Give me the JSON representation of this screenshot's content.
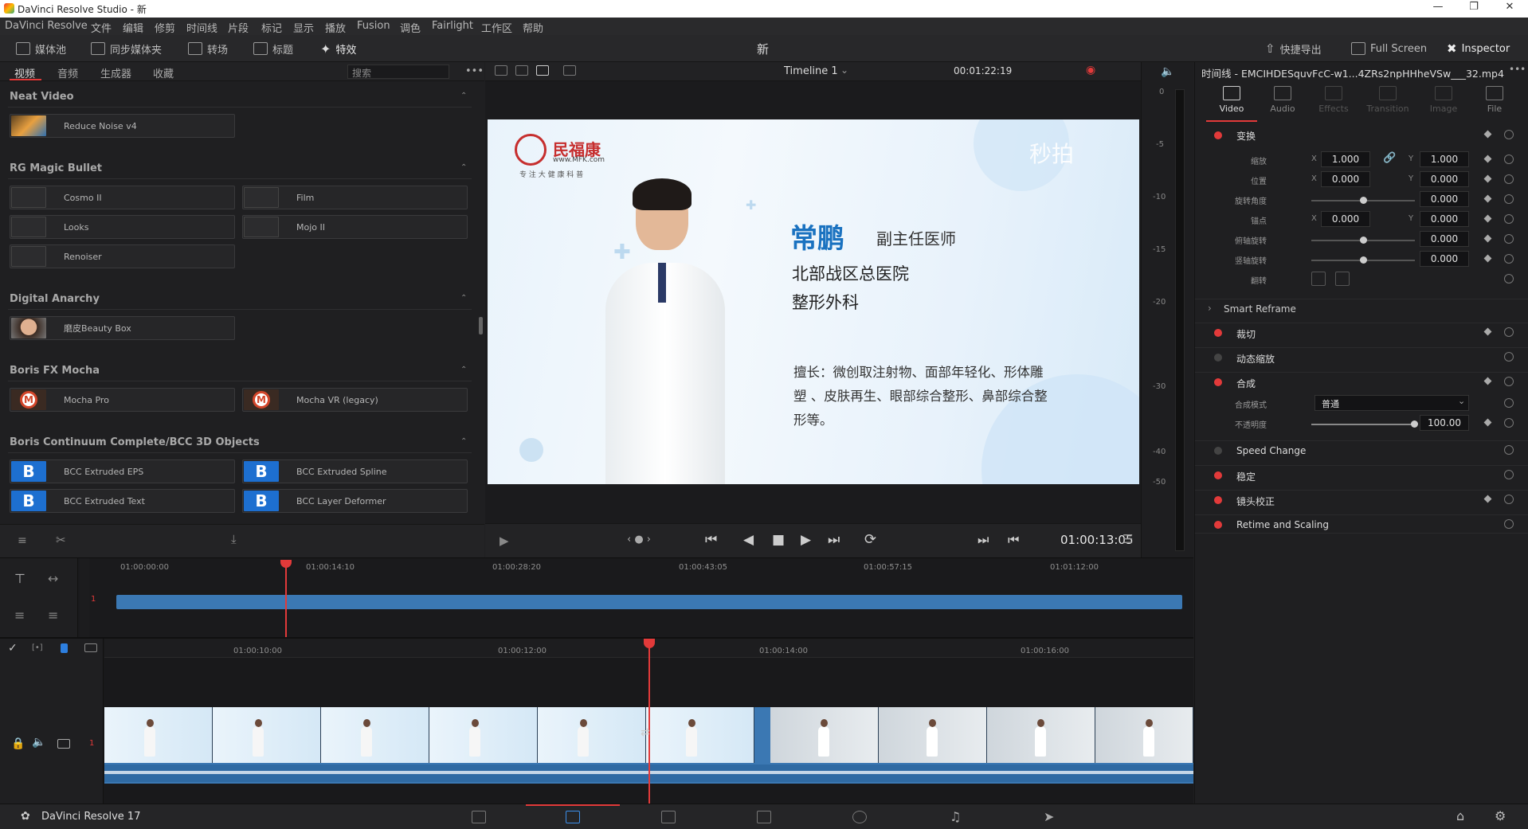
{
  "window": {
    "title": "DaVinci Resolve Studio - 新"
  },
  "menu": [
    "DaVinci Resolve",
    "文件",
    "编辑",
    "修剪",
    "时间线",
    "片段",
    "标记",
    "显示",
    "播放",
    "Fusion",
    "调色",
    "Fairlight",
    "工作区",
    "帮助"
  ],
  "toolbar": {
    "media_pool": "媒体池",
    "sync_bin": "同步媒体夹",
    "transitions": "转场",
    "titles": "标题",
    "effects": "特效",
    "project_name": "新",
    "quick_export": "快捷导出",
    "full_screen": "Full Screen",
    "inspector": "Inspector"
  },
  "library": {
    "tabs": [
      "视频",
      "音频",
      "生成器",
      "收藏"
    ],
    "search_placeholder": "搜索",
    "categories": [
      {
        "name": "Neat Video",
        "items": [
          "Reduce Noise v4"
        ]
      },
      {
        "name": "RG Magic Bullet",
        "items": [
          "Cosmo II",
          "Film",
          "Looks",
          "Mojo II",
          "Renoiser"
        ]
      },
      {
        "name": "Digital Anarchy",
        "items": [
          "磨皮Beauty Box"
        ]
      },
      {
        "name": "Boris FX Mocha",
        "items": [
          "Mocha Pro",
          "Mocha VR (legacy)"
        ]
      },
      {
        "name": "Boris Continuum Complete/BCC 3D Objects",
        "items": [
          "BCC Extruded EPS",
          "BCC Extruded Spline",
          "BCC Extruded Text",
          "BCC Layer Deformer"
        ]
      }
    ],
    "icon_letters": {
      "mocha": "M",
      "bcc": "B"
    }
  },
  "viewer": {
    "timeline_name": "Timeline 1",
    "duration": "00:01:22:19",
    "current_timecode": "01:00:13:05",
    "frame": {
      "logo_name": "民福康",
      "logo_url": "www.MFK.com",
      "logo_tagline": "专 注 大 健 康 科 普",
      "watermark": "秒拍",
      "doctor_name": "常鹏",
      "doctor_title": "副主任医师",
      "hospital": "北部战区总医院",
      "department": "整形外科",
      "specialty_line1": "擅长：微创取注射物、面部年轻化、形体雕",
      "specialty_line2": "塑 、皮肤再生、眼部综合整形、鼻部综合整",
      "specialty_line3": "形等。"
    }
  },
  "meters": {
    "scale": [
      "0",
      "-5",
      "-10",
      "-15",
      "-20",
      "-30",
      "-40",
      "-50"
    ]
  },
  "inspector": {
    "clip_title": "时间线 - EMCIHDESquvFcC-w1...4ZRs2npHHheVSw___32.mp4",
    "tabs": [
      "Video",
      "Audio",
      "Effects",
      "Transition",
      "Image",
      "File"
    ],
    "transform": {
      "label": "变换",
      "zoom_label": "缩放",
      "zoom_x": "1.000",
      "zoom_y": "1.000",
      "position_label": "位置",
      "pos_x": "0.000",
      "pos_y": "0.000",
      "rotation_label": "旋转角度",
      "rotation": "0.000",
      "anchor_label": "锚点",
      "anchor_x": "0.000",
      "anchor_y": "0.000",
      "pitch_label": "俯轴旋转",
      "pitch": "0.000",
      "yaw_label": "竖轴旋转",
      "yaw": "0.000",
      "flip_label": "翻转",
      "x_letter": "X",
      "y_letter": "Y"
    },
    "smart_reframe": "Smart Reframe",
    "crop": "裁切",
    "dynamic_zoom": "动态缩放",
    "composite": {
      "label": "合成",
      "mode_label": "合成模式",
      "mode_value": "普通",
      "opacity_label": "不透明度",
      "opacity": "100.00"
    },
    "speed_change": "Speed Change",
    "stabilization": "稳定",
    "lens_correction": "镜头校正",
    "retime_scaling": "Retime and Scaling"
  },
  "timeline": {
    "upper_ruler": [
      "01:00:00:00",
      "01:00:14:10",
      "01:00:28:20",
      "01:00:43:05",
      "01:00:57:15",
      "01:01:12:00"
    ],
    "lower_ruler": [
      "01:00:10:00",
      "01:00:12:00",
      "01:00:14:00",
      "01:00:16:00"
    ],
    "track_number": "1"
  },
  "bottom": {
    "app_name": "DaVinci Resolve 17"
  },
  "colors": {
    "accent_red": "#e23a3a",
    "clip_blue": "#3b78b3",
    "bcc_blue": "#1d6fd0"
  }
}
